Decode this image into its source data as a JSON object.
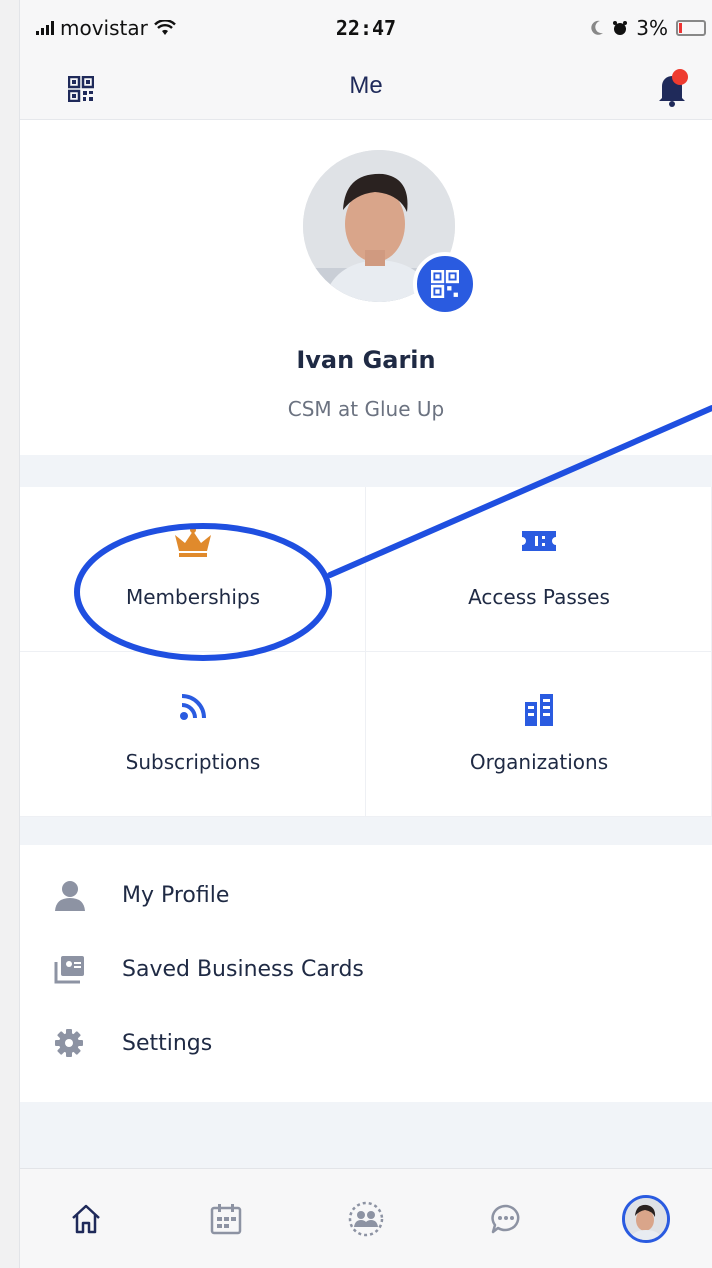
{
  "status_bar": {
    "carrier": "movistar",
    "time": "22:47",
    "battery": "3%"
  },
  "header": {
    "title": "Me",
    "qr_icon": "qr-code-icon",
    "bell_icon": "notification-bell-icon"
  },
  "profile": {
    "name": "Ivan Garin",
    "title": "CSM at Glue Up"
  },
  "grid": [
    {
      "label": "Memberships",
      "icon": "crown-icon"
    },
    {
      "label": "Access Passes",
      "icon": "ticket-icon"
    },
    {
      "label": "Subscriptions",
      "icon": "rss-icon"
    },
    {
      "label": "Organizations",
      "icon": "buildings-icon"
    }
  ],
  "menu": [
    {
      "label": "My Profile",
      "icon": "person-icon"
    },
    {
      "label": "Saved Business Cards",
      "icon": "business-card-icon"
    },
    {
      "label": "Settings",
      "icon": "gear-icon"
    }
  ],
  "tabs": [
    {
      "icon": "home-icon"
    },
    {
      "icon": "calendar-icon"
    },
    {
      "icon": "community-icon"
    },
    {
      "icon": "chat-icon"
    },
    {
      "icon": "profile-avatar-icon"
    }
  ],
  "colors": {
    "accent": "#2a5be0",
    "crown": "#e08a2c",
    "text": "#1f2a44",
    "annotation": "#1f4fe0"
  }
}
